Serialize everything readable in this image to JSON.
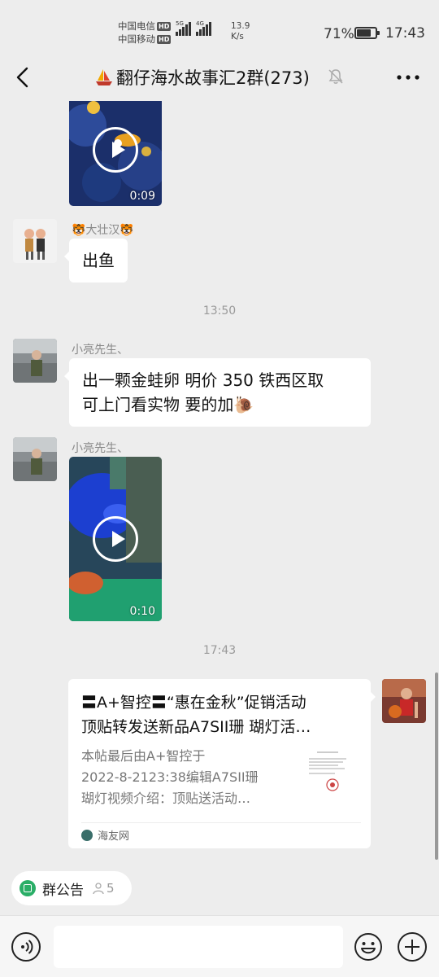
{
  "status_bar": {
    "carrier1": "中国电信",
    "carrier2": "中国移动",
    "hd": "HD",
    "sig1_label": "5G",
    "sig2_label": "4G",
    "net_speed_value": "13.9",
    "net_speed_unit": "K/s",
    "battery_percent": "71%",
    "battery_level": 0.71,
    "time": "17:43"
  },
  "header": {
    "title": "翻仔海水故事汇2群(273)",
    "title_icon": "sailboat-emoji",
    "muted": true
  },
  "messages": [
    {
      "type": "video",
      "sender": "",
      "duration": "0:09"
    },
    {
      "type": "text",
      "sender": "🐯大壮汉🐯",
      "text": "出鱼"
    },
    {
      "type": "time",
      "text": "13:50"
    },
    {
      "type": "text",
      "sender": "小亮先生、",
      "lines": [
        "出一颗金蛙卵 明价 350 铁西区取",
        "可上门看实物 要的加🐌"
      ]
    },
    {
      "type": "video",
      "sender": "小亮先生、",
      "duration": "0:10"
    },
    {
      "type": "time",
      "text": "17:43"
    },
    {
      "type": "link",
      "title_line1": "〓A+智控〓“惠在金秋”促销活动",
      "title_line2": "顶贴转发送新品A7SII珊 瑚灯活…",
      "desc_line1": "本帖最后由A+智控于",
      "desc_line2": "2022-8-2123:38编辑A7SII珊",
      "desc_line3": "瑚灯视频介绍：顶贴送活动…",
      "source": "海友网"
    }
  ],
  "notice": {
    "label": "群公告",
    "count": "5"
  },
  "input": {
    "placeholder": ""
  },
  "colors": {
    "background": "#ededed",
    "bubble": "#ffffff",
    "notice_green": "#2aae67"
  }
}
